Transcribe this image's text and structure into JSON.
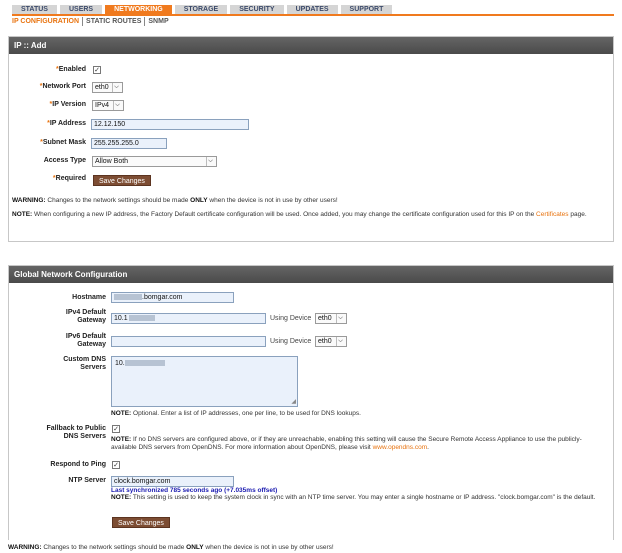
{
  "nav": {
    "tabs": [
      "STATUS",
      "USERS",
      "NETWORKING",
      "STORAGE",
      "SECURITY",
      "UPDATES",
      "SUPPORT"
    ],
    "active_tab": "NETWORKING",
    "subtabs": [
      "IP CONFIGURATION",
      "STATIC ROUTES",
      "SNMP"
    ]
  },
  "ip_add": {
    "title": "IP :: Add",
    "enabled_label": "Enabled",
    "enabled_checked": true,
    "network_port_label": "Network Port",
    "network_port_value": "eth0",
    "ip_version_label": "IP Version",
    "ip_version_value": "IPv4",
    "ip_address_label": "IP Address",
    "ip_address_value": "12.12.150",
    "subnet_mask_label": "Subnet Mask",
    "subnet_mask_value": "255.255.255.0",
    "access_type_label": "Access Type",
    "access_type_value": "Allow Both",
    "required_label": "Required",
    "save_button": "Save Changes",
    "warning_prefix": "WARNING:",
    "warning_text_1": " Changes to the network settings should be made ",
    "warning_only": "ONLY",
    "warning_text_2": " when the device is not in use by other users!",
    "note_prefix": "NOTE:",
    "note_text_1": " When configuring a new IP address, the Factory Default certificate configuration will be used. Once added, you may change the certificate configuration used for this IP on the ",
    "note_link": "Certificates",
    "note_text_2": " page."
  },
  "global": {
    "title": "Global Network Configuration",
    "hostname_label": "Hostname",
    "hostname_value": ".bomgar.com",
    "ipv4_gateway_label_1": "IPv4 Default",
    "ipv4_gateway_label_2": "Gateway",
    "ipv4_gateway_value": "10.1",
    "using_device_label": "Using Device",
    "ipv4_device_value": "eth0",
    "ipv6_gateway_label_1": "IPv6 Default",
    "ipv6_gateway_label_2": "Gateway",
    "ipv6_gateway_value": "",
    "ipv6_device_value": "eth0",
    "dns_label_1": "Custom DNS",
    "dns_label_2": "Servers",
    "dns_value": "10.",
    "dns_note_prefix": "NOTE:",
    "dns_note_text": " Optional. Enter a list of IP addresses, one per line, to be used for DNS lookups.",
    "fallback_label_1": "Fallback to Public",
    "fallback_label_2": "DNS Servers",
    "fallback_checked": true,
    "fallback_note_prefix": "NOTE:",
    "fallback_note_text": " If no DNS servers are configured above, or if they are unreachable, enabling this setting will cause the Secure Remote Access Appliance to use the publicly-available DNS servers from OpenDNS. For more information about OpenDNS, please visit ",
    "fallback_link": "www.opendns.com",
    "fallback_note_end": ".",
    "ping_label": "Respond to Ping",
    "ping_checked": true,
    "ntp_label": "NTP Server",
    "ntp_value": "clock.bomgar.com",
    "ntp_sync": "Last synchronized 785 seconds ago (+7.035ms offset)",
    "ntp_note_prefix": "NOTE:",
    "ntp_note_text": " This setting is used to keep the system clock in sync with an NTP time server. You may enter a single hostname or IP address. \"clock.bomgar.com\" is the default.",
    "save_button": "Save Changes"
  },
  "footer": {
    "warning_prefix": "WARNING:",
    "warning_text_1": " Changes to the network settings should be made ",
    "warning_only": "ONLY",
    "warning_text_2": " when the device is not in use by other users!"
  },
  "colors": {
    "accent": "#f07a1e",
    "button": "#7d4d33",
    "header": "#555555",
    "input_bg": "#eaf1fb",
    "sync_text": "#1a1ab0"
  }
}
